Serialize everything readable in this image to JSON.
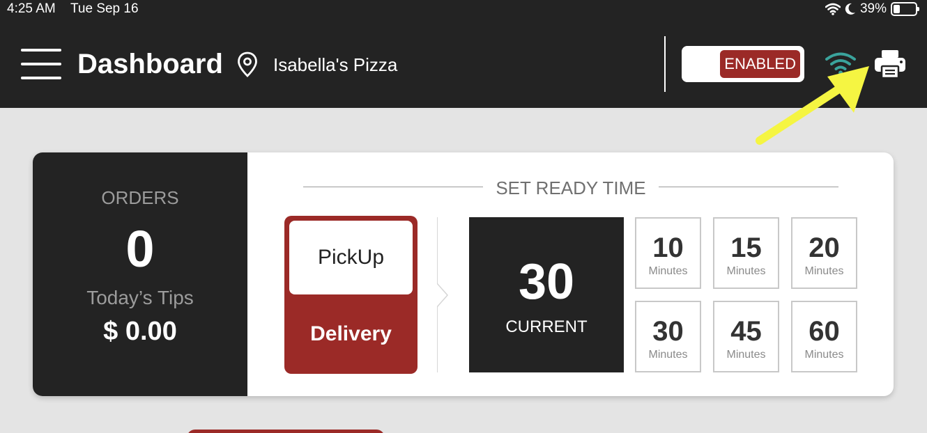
{
  "status_bar": {
    "time": "4:25 AM",
    "date": "Tue Sep 16",
    "battery": "39%"
  },
  "header": {
    "title": "Dashboard",
    "location": "Isabella's Pizza",
    "toggle_label": "ENABLED"
  },
  "stats": {
    "orders_label": "ORDERS",
    "orders_count": "0",
    "tips_label": "Today’s Tips",
    "tips_value": "$ 0.00"
  },
  "ready_time": {
    "heading": "SET READY TIME",
    "pickup_label": "PickUp",
    "delivery_label": "Delivery",
    "current_value": "30",
    "current_label": "CURRENT",
    "options": [
      {
        "value": "10",
        "unit": "Minutes"
      },
      {
        "value": "15",
        "unit": "Minutes"
      },
      {
        "value": "20",
        "unit": "Minutes"
      },
      {
        "value": "30",
        "unit": "Minutes"
      },
      {
        "value": "45",
        "unit": "Minutes"
      },
      {
        "value": "60",
        "unit": "Minutes"
      }
    ]
  },
  "colors": {
    "accent": "#9b2a27",
    "dark": "#232323",
    "wifi": "#3aa39c",
    "annotation_arrow": "#f5f542"
  }
}
